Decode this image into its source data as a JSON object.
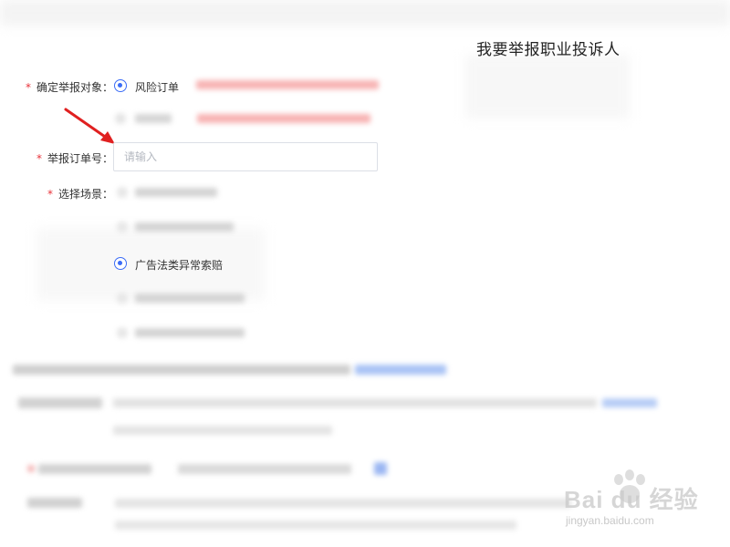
{
  "page": {
    "title": "我要举报职业投诉人"
  },
  "form": {
    "target_field": {
      "required_mark": "*",
      "label": "确定举报对象：",
      "selected_option": "风险订单"
    },
    "order_field": {
      "required_mark": "*",
      "label": "举报订单号：",
      "placeholder": "请输入",
      "value": ""
    },
    "scene_field": {
      "required_mark": "*",
      "label": "选择场景：",
      "selected_option": "广告法类异常索赔"
    }
  },
  "colors": {
    "accent": "#3b6cf6",
    "required": "#e8333a",
    "arrow": "#e02020"
  },
  "icons": {
    "pointer": "red-arrow-icon"
  },
  "watermark": {
    "brand": "Bai du 经验",
    "url": "jingyan.baidu.com"
  }
}
